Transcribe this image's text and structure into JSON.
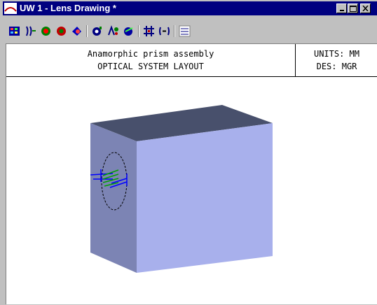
{
  "window": {
    "title": "UW 1 - Lens Drawing *",
    "title_bar_color": "#000080",
    "controls": [
      "minimize",
      "maximize",
      "close"
    ]
  },
  "toolbar": {
    "icons": [
      "layout-icon",
      "lens-element-icon",
      "spot-diagram-icon",
      "rotate-icon",
      "wavefront-icon",
      "zoom-icon",
      "aberration-icon",
      "ray-plot-icon",
      "grid-icon",
      "text-icon",
      "grid-toggle-icon"
    ]
  },
  "drawing": {
    "title_line1": "Anamorphic prism assembly",
    "title_line2": "OPTICAL SYSTEM LAYOUT",
    "units": "UNITS: MM",
    "designer": "DES: MGR",
    "colors": {
      "block_top": "#48506c",
      "block_side": "#7c84b4",
      "block_front": "#a8b0ec",
      "rays_blue": "#0000ff",
      "rays_green": "#00a000"
    }
  }
}
